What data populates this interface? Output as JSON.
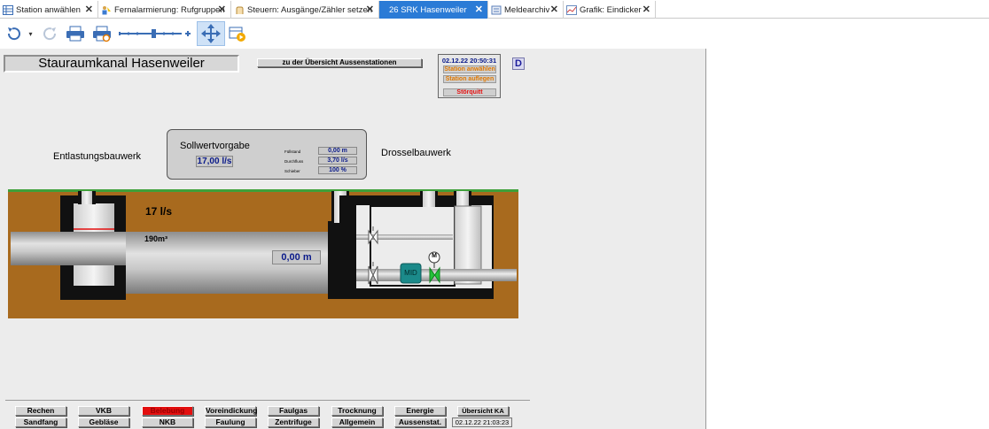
{
  "tabs": [
    {
      "label": "Station anwählen",
      "icon": "table-icon",
      "active": false
    },
    {
      "label": "Fernalarmierung: Rufgruppen",
      "icon": "people-icon",
      "active": false
    },
    {
      "label": "Steuern: Ausgänge/Zähler setzen",
      "icon": "hand-icon",
      "active": false
    },
    {
      "label": "26 SRK Hasenweiler",
      "icon": "",
      "active": true
    },
    {
      "label": "Meldearchiv",
      "icon": "archive-icon",
      "active": false
    },
    {
      "label": "Grafik: Eindicker",
      "icon": "chart-icon",
      "active": false
    }
  ],
  "toolbar": {
    "undo": "undo-icon",
    "redo": "redo-icon",
    "print": "print-icon",
    "print_preview": "print-preview-icon",
    "zoom": "zoom-slider",
    "move": "move-icon",
    "play": "play-icon"
  },
  "header": {
    "title": "Stauraumkanal Hasenweiler",
    "overview_button": "zu der Übersicht Aussenstationen",
    "datetime": "02.12.22 20:50:31",
    "station_select": "Station anwählen",
    "station_hangup": "Station auflegen",
    "fault_ack": "Störquitt",
    "d_button": "D"
  },
  "setpoint": {
    "title": "Sollwertvorgabe",
    "value": "17,00 l/s",
    "rows": [
      {
        "label": "Füllstand",
        "value": "0,00 m"
      },
      {
        "label": "Durchfluss",
        "value": "3,70 l/s"
      },
      {
        "label": "Schieber",
        "value": "100 %"
      }
    ]
  },
  "process": {
    "relief_structure": "Entlastungsbauwerk",
    "throttle_structure": "Drosselbauwerk",
    "flow": "17 l/s",
    "volume": "190m³",
    "level": "0,00 m",
    "mid": "MID",
    "motor": "M"
  },
  "nav": {
    "row1": [
      "Rechen",
      "VKB",
      "Belebung",
      "Voreindickung",
      "Faulgas",
      "Trocknung",
      "Energie",
      "Übersicht KA"
    ],
    "row2": [
      "Sandfang",
      "Gebläse",
      "NKB",
      "Faulung",
      "Zentrifuge",
      "Allgemein",
      "Aussenstat.",
      "02.12.22 21:03:23"
    ]
  },
  "colors": {
    "active_tab": "#2b7bd6",
    "alarm_red": "#e30f0f",
    "soil": "#a86a1e",
    "grass": "#3fa03a",
    "value_blue": "#0a1a8a",
    "status_orange": "#e07800"
  }
}
